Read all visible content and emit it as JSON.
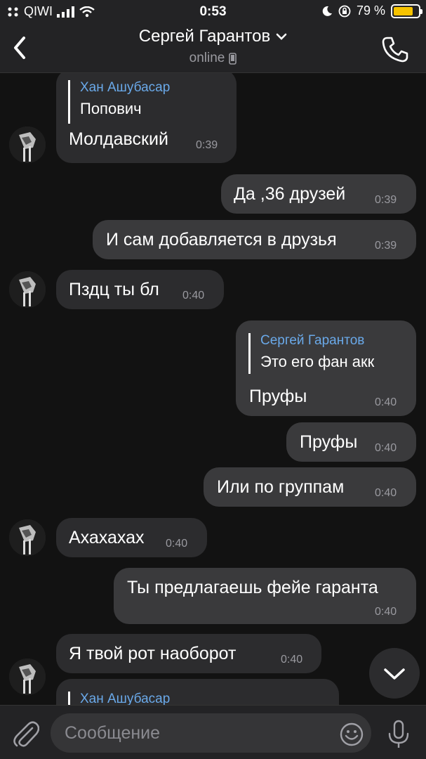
{
  "status_bar": {
    "carrier": "QIWI",
    "time": "0:53",
    "battery": "79 %",
    "battery_level": 0.79
  },
  "header": {
    "contact_name": "Сергей Гарантов",
    "status": "online"
  },
  "messages": [
    {
      "quote_author": "Хан Ашубасар",
      "quote_text": "Попович",
      "text": "Молдавский",
      "time": "0:39"
    },
    {
      "text": "Да ,36 друзей",
      "time": "0:39"
    },
    {
      "text": "И сам добавляется в друзья",
      "time": "0:39"
    },
    {
      "text": "Пздц ты бл",
      "time": "0:40"
    },
    {
      "quote_author": "Сергей Гарантов",
      "quote_text": "Это его фан акк",
      "text": "Пруфы",
      "time": "0:40"
    },
    {
      "text": "Пруфы",
      "time": "0:40"
    },
    {
      "text": "Или по группам",
      "time": "0:40"
    },
    {
      "text": "Ахахахах",
      "time": "0:40"
    },
    {
      "text": "Ты предлагаешь фейе гаранта",
      "time": "0:40"
    },
    {
      "text": "Я твой рот наоборот",
      "time": "0:40"
    },
    {
      "quote_author": "Хан Ашубасар"
    }
  ],
  "composer": {
    "placeholder": "Сообщение"
  },
  "colors": {
    "background": "#121212",
    "incoming_bubble": "#2c2c2e",
    "outgoing_bubble": "#3a3a3c",
    "quote_author": "#6aa9e9",
    "battery": "#f6c300"
  }
}
